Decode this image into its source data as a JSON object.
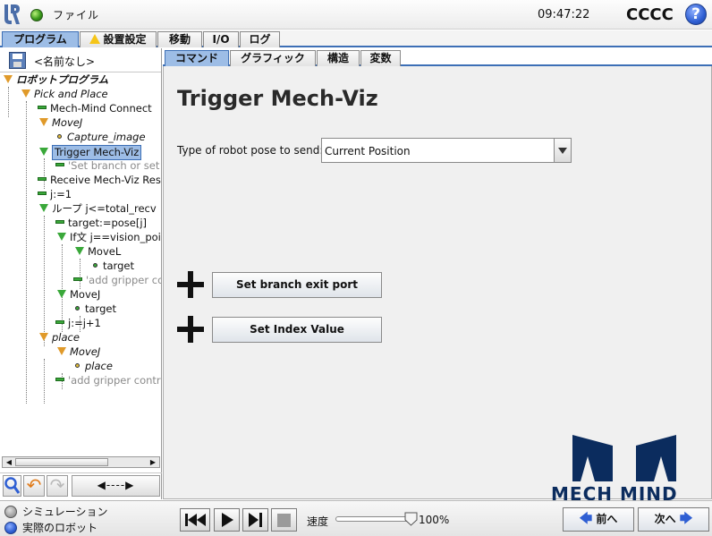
{
  "header": {
    "file_menu": "ファイル",
    "time": "09:47:22",
    "robot_name": "CCCC",
    "help_label": "?"
  },
  "main_tabs": [
    {
      "label": "プログラム",
      "active": true
    },
    {
      "label": "設置設定",
      "active": false,
      "warning": true
    },
    {
      "label": "移動",
      "active": false
    },
    {
      "label": "I/O",
      "active": false
    },
    {
      "label": "ログ",
      "active": false
    }
  ],
  "program": {
    "name": "<名前なし>"
  },
  "tree": {
    "root": "ロボットプログラム",
    "items": [
      {
        "label": "Pick and Place"
      },
      {
        "label": "Mech-Mind Connect"
      },
      {
        "label": "MoveJ"
      },
      {
        "label": "Capture_image"
      },
      {
        "label": "Trigger Mech-Viz"
      },
      {
        "label": "'Set branch or set i"
      },
      {
        "label": "Receive Mech-Viz Res"
      },
      {
        "label": "j:=1"
      },
      {
        "label": "ループ j<=total_recv"
      },
      {
        "label": "target:=pose[j]"
      },
      {
        "label": "If文 j==vision_poi"
      },
      {
        "label": "MoveL"
      },
      {
        "label": "target"
      },
      {
        "label": "'add gripper co"
      },
      {
        "label": "MoveJ"
      },
      {
        "label": "target"
      },
      {
        "label": "j:=j+1"
      },
      {
        "label": "place"
      },
      {
        "label": "MoveJ"
      },
      {
        "label": "place"
      },
      {
        "label": "'add gripper contro"
      }
    ]
  },
  "tools": {
    "move_arrows": "◀----▶"
  },
  "sub_tabs": [
    {
      "label": "コマンド",
      "active": true
    },
    {
      "label": "グラフィック",
      "active": false
    },
    {
      "label": "構造",
      "active": false
    },
    {
      "label": "変数",
      "active": false
    }
  ],
  "node": {
    "title": "Trigger Mech-Viz",
    "pose_label": "Type of robot pose to send:",
    "pose_value": "Current Position",
    "btn_branch": "Set branch exit port",
    "btn_index": "Set Index Value"
  },
  "logo": {
    "text": "MECH MIND",
    "color": "#0b2c5e"
  },
  "footer": {
    "simulation": "シミュレーション",
    "real_robot": "実際のロボット",
    "speed_label": "速度",
    "speed_value": "100%",
    "speed_fraction": 1.0,
    "prev": "前へ",
    "next": "次へ"
  },
  "colors": {
    "accent": "#3d6fb6",
    "selected": "#9dbde6",
    "node_green": "#3aa83a",
    "node_orange": "#e09a2a"
  }
}
